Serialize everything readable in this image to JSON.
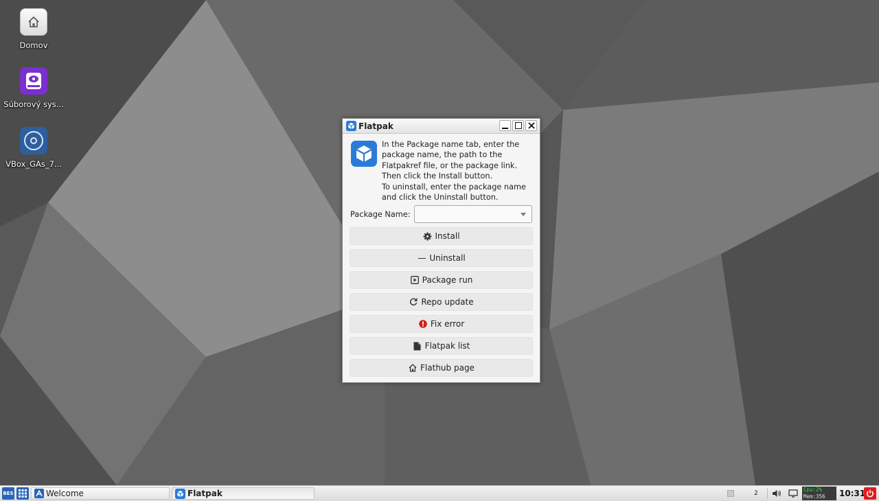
{
  "desktop": {
    "icons": [
      {
        "label": "Domov",
        "icon": "home-folder-icon"
      },
      {
        "label": "Súborový sys...",
        "icon": "drive-icon"
      },
      {
        "label": "VBox_GAs_7...",
        "icon": "optical-disc-icon"
      }
    ]
  },
  "window": {
    "title": "Flatpak",
    "buttons": {
      "minimize": "minimize-icon",
      "maximize": "maximize-icon",
      "close": "close-icon"
    },
    "info_lines": [
      "In the Package name tab, enter the",
      "package name, the path to the",
      "Flatpakref file, or the package link.",
      "Then click the Install button.",
      "To uninstall, enter the package name",
      "and click the Uninstall button."
    ],
    "package_label": "Package Name:",
    "package_value": "",
    "actions": [
      {
        "label": "Install",
        "icon": "gear-icon"
      },
      {
        "label": "Uninstall",
        "icon": "minus-icon"
      },
      {
        "label": "Package run",
        "icon": "play-icon"
      },
      {
        "label": "Repo update",
        "icon": "refresh-icon"
      },
      {
        "label": "Fix error",
        "icon": "error-icon"
      },
      {
        "label": "Flatpak list",
        "icon": "document-icon"
      },
      {
        "label": "Flathub page",
        "icon": "home-icon"
      }
    ]
  },
  "taskbar": {
    "launcher_text": "BES",
    "tasks": [
      {
        "label": "Welcome",
        "icon": "welcome-icon"
      },
      {
        "label": "Flatpak",
        "icon": "flatpak-icon"
      }
    ],
    "workspace": "2",
    "cpu": "Cpu:2%",
    "mem": "Mem:356",
    "clock": "10:31",
    "colors": {
      "power": "#e01b1b",
      "cpu_text": "#2ee04a"
    }
  }
}
